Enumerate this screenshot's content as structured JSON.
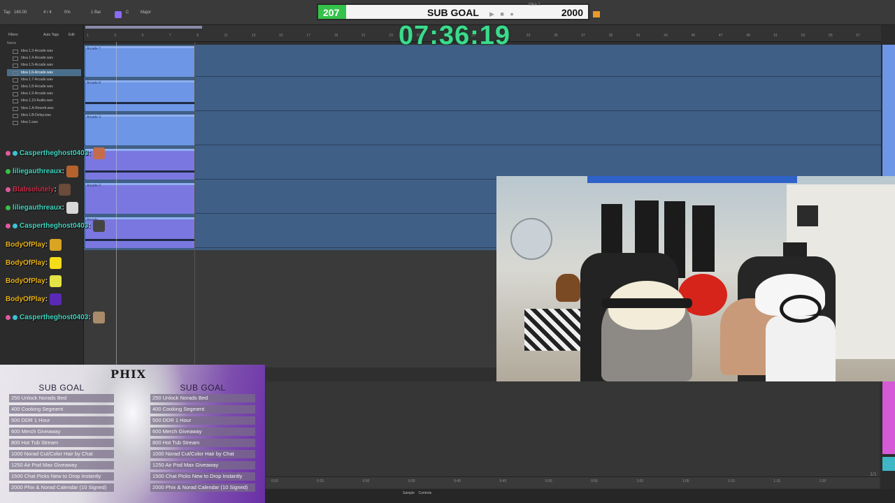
{
  "transport": {
    "tap": "Tap",
    "tempo": "160.00",
    "signature": "4 / 4",
    "metronome_pct": "0%",
    "bar_setting": "1 Bar",
    "scale_key": "C",
    "scale_mode": "Major",
    "controls": "▶ ■ ●",
    "idea_label": "Idea 1"
  },
  "sub_goal_bar": {
    "current": "207",
    "label": "SUB GOAL",
    "target": "2000",
    "progress_fraction": 0.1035
  },
  "timer": "07:36:19",
  "browser": {
    "filters_label": "Filters",
    "autotags_label": "Auto Tags",
    "edit_label": "Edit",
    "name_header": "Name",
    "files": [
      "Idea 1.3-Arcade.wav",
      "Idea 1.4-Arcade.wav",
      "Idea 1.5-Arcade.wav",
      "Idea 1.6-Arcade.wav",
      "Idea 1.7-Arcade.wav",
      "Idea 1.8-Arcade.wav",
      "Idea 1.9-Arcade.wav",
      "Idea 1.10-Audio.wav",
      "Idea 1.A-Reverb.wav",
      "Idea 1.B-Delay.wav",
      "Idea 1.wav"
    ],
    "selected_index": 3
  },
  "ruler_ticks": [
    "1",
    "3",
    "5",
    "7",
    "9",
    "11",
    "13",
    "15",
    "17",
    "19",
    "21",
    "23",
    "25",
    "27",
    "29",
    "31",
    "33",
    "35",
    "37",
    "39",
    "41",
    "43",
    "45",
    "47",
    "49",
    "51",
    "53",
    "55",
    "57"
  ],
  "clips": [
    "Arcade 7",
    "Arcade 8",
    "Arcade 3",
    "",
    "Arcade 2",
    "Arcade"
  ],
  "chat": [
    {
      "user": "Caspertheghost0403",
      "color": "#3fd6c0",
      "badges": [
        "#e05aa0",
        "#39c5d6"
      ]
    },
    {
      "user": "liliegauthreaux",
      "color": "#3fd6c0",
      "badges": [
        "#35c24a"
      ]
    },
    {
      "user": "Blabsolutely",
      "color": "#c8304a",
      "badges": [
        "#e05aa0"
      ]
    },
    {
      "user": "liliegauthreaux",
      "color": "#3fd6c0",
      "badges": [
        "#35c24a"
      ]
    },
    {
      "user": "Caspertheghost0403",
      "color": "#3fd6c0",
      "badges": [
        "#e05aa0",
        "#39c5d6"
      ]
    },
    {
      "user": "BodyOfPlay",
      "color": "#e8b21a",
      "badges": []
    },
    {
      "user": "BodyOfPlay",
      "color": "#e8b21a",
      "badges": []
    },
    {
      "user": "BodyOfPlay",
      "color": "#e8b21a",
      "badges": []
    },
    {
      "user": "BodyOfPlay",
      "color": "#e8b21a",
      "badges": []
    },
    {
      "user": "Caspertheghost0403",
      "color": "#3fd6c0",
      "badges": [
        "#e05aa0",
        "#39c5d6"
      ]
    }
  ],
  "goals_panel": {
    "logo": "PHIX",
    "left_title": "SUB GOAL",
    "right_title": "SUB GOAL",
    "items": [
      "250 Unlock Norads Bed",
      "400 Cooking Segment",
      "500 DDR 1 Hour",
      "600 Merch Giveaway",
      "800 Hot Tub Stream",
      "1000 Norad Cut/Color Hair by Chat",
      "1250 Air Pod Max Giveaway",
      "1500 Chat Picks New to Drop Instantly",
      "2000 Phix & Norad Calendar (10 Signed)"
    ]
  },
  "bottom_ruler": [
    "0:20",
    "0:25",
    "0:30",
    "0:35",
    "0:40",
    "0:45",
    "0:50",
    "0:55",
    "1:00",
    "1:05",
    "1:10",
    "1:15",
    "1:20"
  ],
  "status": {
    "sample": "Sample",
    "controls": "Controls"
  },
  "page_indicator": "1/1",
  "colors": {
    "accent_green": "#3cda8c",
    "clip_blue": "#6d96e6",
    "goal_bar_fill": "#34c24a"
  }
}
